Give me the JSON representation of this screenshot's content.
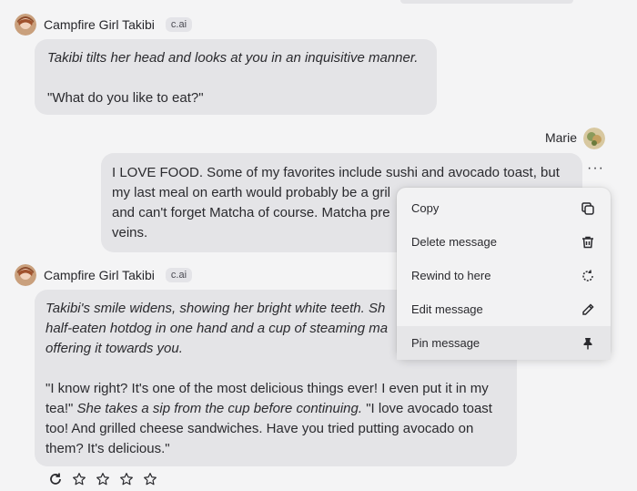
{
  "messages": [
    {
      "author": "Campfire Girl Takibi",
      "badge": "c.ai",
      "lines": [
        {
          "italic": "Takibi tilts her head and looks at you in an inquisitive manner."
        },
        {
          "plain": "\"What do you like to eat?\""
        }
      ]
    },
    {
      "author": "Marie",
      "text_lines": [
        "I LOVE FOOD. Some of my favorites include sushi and avocado toast, but",
        "my last meal on earth would probably be a gril",
        "and can't forget Matcha of course. Matcha pre",
        "veins."
      ],
      "more_label": "···"
    },
    {
      "author": "Campfire Girl Takibi",
      "badge": "c.ai",
      "lines": [
        "Takibi's smile widens, showing her bright white teeth. Sh",
        "half-eaten hotdog in one hand and a cup of steaming ma",
        "offering it towards you."
      ],
      "quote_parts": {
        "q1": "\"I know right? It's one of the most delicious things ever! I even put it in my",
        "q2a": "tea!\" ",
        "q2b": "She takes a sip from the cup before continuing.",
        "q2c": " \"I love avocado toast",
        "q3": "too! And grilled cheese sandwiches. Have you tried putting avocado on",
        "q4": "them? It's delicious.\""
      }
    }
  ],
  "context_menu": {
    "items": [
      {
        "label": "Copy",
        "icon": "copy-icon"
      },
      {
        "label": "Delete message",
        "icon": "trash-icon"
      },
      {
        "label": "Rewind to here",
        "icon": "rewind-icon"
      },
      {
        "label": "Edit message",
        "icon": "pencil-icon"
      },
      {
        "label": "Pin message",
        "icon": "pin-icon"
      }
    ]
  },
  "rating": {
    "stars": 4,
    "icons": [
      "refresh-icon",
      "star-icon"
    ]
  }
}
